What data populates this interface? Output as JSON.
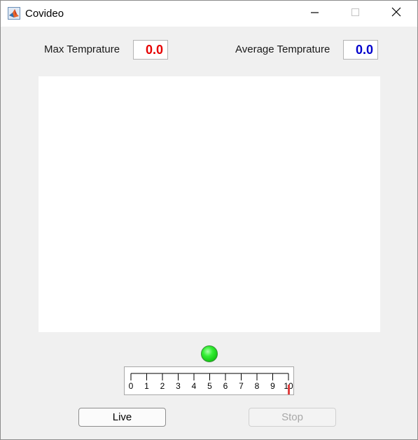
{
  "window": {
    "title": "Covideo",
    "icon": "matlab-icon",
    "controls": [
      "minimize-icon",
      "maximize-icon",
      "close-icon"
    ]
  },
  "max_temp": {
    "label": "Max Temprature",
    "value": "0.0",
    "color": "#e60000"
  },
  "avg_temp": {
    "label": "Average Temprature",
    "value": "0.0",
    "color": "#0000cc"
  },
  "lamp": {
    "state": "on",
    "color": "#22dd22"
  },
  "gauge": {
    "ticks": [
      "0",
      "1",
      "2",
      "3",
      "4",
      "5",
      "6",
      "7",
      "8",
      "9",
      "10"
    ],
    "min": 0,
    "max": 10,
    "value": 10,
    "needle_color": "#e04040"
  },
  "buttons": {
    "live": "Live",
    "stop": "Stop"
  }
}
